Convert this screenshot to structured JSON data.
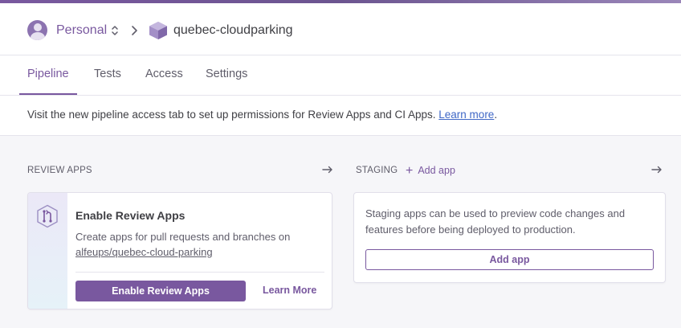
{
  "colors": {
    "accent": "#79589f",
    "link": "#3f67c6",
    "text": "#3f3f44",
    "muted": "#5f5d6a",
    "background": "#f6f6f9"
  },
  "breadcrumb": {
    "team": "Personal",
    "team_icon": "user-avatar-icon",
    "switch_icon": "chevron-up-down-icon",
    "separator_icon": "chevron-right-icon",
    "pipeline_icon": "pipeline-icon",
    "pipeline": "quebec-cloudparking"
  },
  "tabs": [
    {
      "label": "Pipeline",
      "active": true
    },
    {
      "label": "Tests",
      "active": false
    },
    {
      "label": "Access",
      "active": false
    },
    {
      "label": "Settings",
      "active": false
    }
  ],
  "notice": {
    "text": "Visit the new pipeline access tab to set up permissions for Review Apps and CI Apps. ",
    "link": "Learn more",
    "suffix": "."
  },
  "review_apps": {
    "title": "REVIEW APPS",
    "card": {
      "icon": "branch-merge-icon",
      "heading": "Enable Review Apps",
      "description": "Create apps for pull requests and branches on",
      "repo": "alfeups/quebec-cloud-parking",
      "button": "Enable Review Apps",
      "learn_more": "Learn More"
    }
  },
  "staging": {
    "title": "STAGING",
    "add_app": "Add app",
    "description": "Staging apps can be used to preview code changes and features before being deployed to production.",
    "button": "Add app"
  }
}
